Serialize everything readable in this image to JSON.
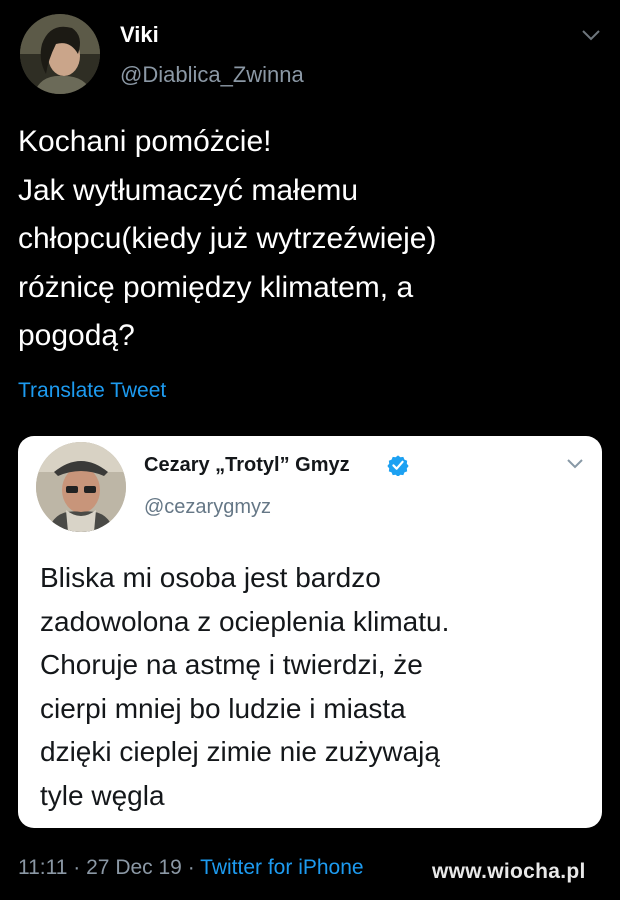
{
  "author": {
    "name": "Viki",
    "handle": "@Diablica_Zwinna"
  },
  "tweet": {
    "lines": [
      "Kochani pomóżcie!",
      "Jak wytłumaczyć małemu",
      "chłopcu(kiedy już wytrzeźwieje)",
      "różnicę pomiędzy klimatem, a",
      "pogodą?"
    ],
    "translate_label": "Translate Tweet"
  },
  "quoted": {
    "name": "Cezary „Trotyl” Gmyz",
    "handle": "@cezarygmyz",
    "verified": true,
    "lines": [
      "Bliska mi osoba jest bardzo",
      "zadowolona z ocieplenia klimatu.",
      "Choruje na astmę i twierdzi, że",
      "cierpi mniej bo ludzie i miasta",
      "dzięki cieplej zimie nie zużywają",
      "tyle węgla"
    ]
  },
  "meta": {
    "time": "11:11",
    "separator": "·",
    "date": "27 Dec 19",
    "source": "Twitter for iPhone"
  },
  "watermark": "www.wiocha.pl",
  "colors": {
    "background": "#000000",
    "link": "#1d9bf0",
    "secondary_text": "#8b98a5",
    "verified": "#1da1f2"
  },
  "icons": [
    "chevron-down-icon",
    "verified-badge-icon"
  ]
}
